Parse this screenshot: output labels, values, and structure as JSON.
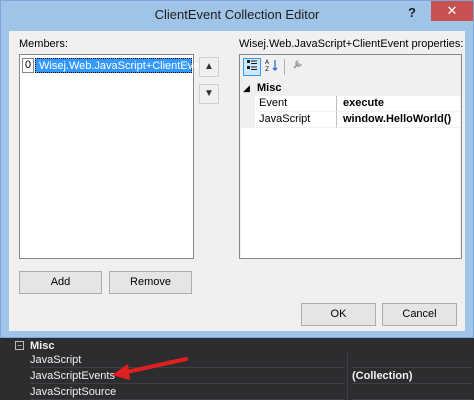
{
  "dialog": {
    "title": "ClientEvent Collection Editor",
    "help_glyph": "?",
    "close_glyph": "✕"
  },
  "members": {
    "label": "Members:",
    "items": [
      {
        "index": "0",
        "name": "Wisej.Web.JavaScript+ClientEvent"
      }
    ],
    "move_up_glyph": "▲",
    "move_down_glyph": "▼",
    "add_label": "Add",
    "remove_label": "Remove"
  },
  "properties": {
    "label": "Wisej.Web.JavaScript+ClientEvent properties:",
    "toolbar": {
      "categorized_icon": "categorized-icon",
      "alphabetical_icon": "alphabetical-icon",
      "property_pages_icon": "wrench-icon"
    },
    "category": {
      "toggle": "◢",
      "name": "Misc"
    },
    "rows": [
      {
        "name": "Event",
        "value": "execute"
      },
      {
        "name": "JavaScript",
        "value": "window.HelloWorld()"
      }
    ]
  },
  "footer": {
    "ok_label": "OK",
    "cancel_label": "Cancel"
  },
  "background_grid": {
    "category": {
      "toggle": "−",
      "name": "Misc"
    },
    "rows": [
      {
        "name": "JavaScript",
        "value": ""
      },
      {
        "name": "JavaScriptEvents",
        "value": "(Collection)"
      },
      {
        "name": "JavaScriptSource",
        "value": ""
      }
    ]
  },
  "colors": {
    "title_bar": "#9fc4e7",
    "close_button": "#c75050",
    "selection": "#3399ff",
    "annotation_arrow": "#e02020",
    "ide_background": "#2d2d30"
  }
}
